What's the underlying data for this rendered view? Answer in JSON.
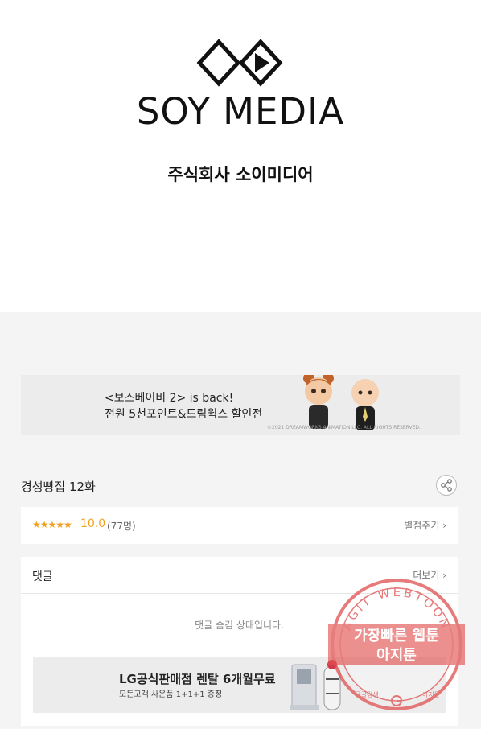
{
  "header": {
    "brand": "SOY MEDIA",
    "company": "주식회사 소이미디어"
  },
  "banner": {
    "line1": "<보스베이비 2> is back!",
    "line2": "전원 5천포인트&드림웍스 할인전",
    "caption": "©2021 DREAMWORKS ANIMATION LLC. ALL RIGHTS RESERVED."
  },
  "episode": {
    "title": "경성빵집 12화"
  },
  "rating": {
    "stars": "★★★★★",
    "score": "10.0",
    "count": "(77명)",
    "action": "별점주기 ›"
  },
  "comments": {
    "title": "댓글",
    "more": "더보기 ›",
    "hidden_notice": "댓글 숨김 상태입니다."
  },
  "ad": {
    "title": "LG공식판매점 렌탈 6개월무료",
    "subtitle": "모든고객 사은품 1+1+1 증정"
  },
  "watermark": {
    "ring_text": "AGIT WEBTOON",
    "line1": "가장빠른 웹툰",
    "line2": "아지툰",
    "foot_left": "구글검색",
    "foot_right": "아지툰"
  },
  "colors": {
    "accent": "#f0a020",
    "stamp": "#e05050"
  }
}
